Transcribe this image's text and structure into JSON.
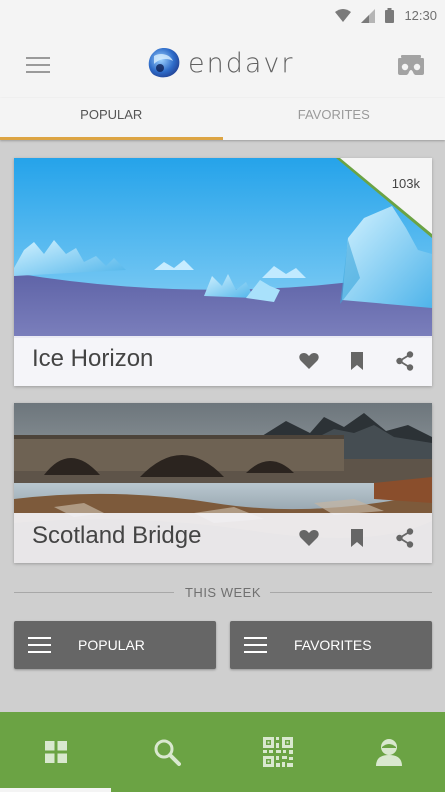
{
  "status_bar": {
    "time": "12:30"
  },
  "app": {
    "brand": "endavr"
  },
  "tabs": [
    {
      "label": "POPULAR",
      "active": true
    },
    {
      "label": "FAVORITES",
      "active": false
    }
  ],
  "cards": [
    {
      "title": "Ice Horizon",
      "views": "103k"
    },
    {
      "title": "Scotland Bridge"
    }
  ],
  "section": {
    "label": "THIS WEEK"
  },
  "week_buttons": [
    {
      "label": "POPULAR",
      "icon": "list-icon"
    },
    {
      "label": "FAVORITES",
      "icon": "list-icon"
    }
  ],
  "bottom_nav": [
    {
      "icon": "grid-icon",
      "active": true
    },
    {
      "icon": "search-icon",
      "active": false
    },
    {
      "icon": "qr-code-icon",
      "active": false
    },
    {
      "icon": "profile-icon",
      "active": false
    }
  ],
  "colors": {
    "accent": "#dca443",
    "nav": "#6ba344",
    "button": "#666666",
    "badge_ribbon": "#6ba344"
  }
}
